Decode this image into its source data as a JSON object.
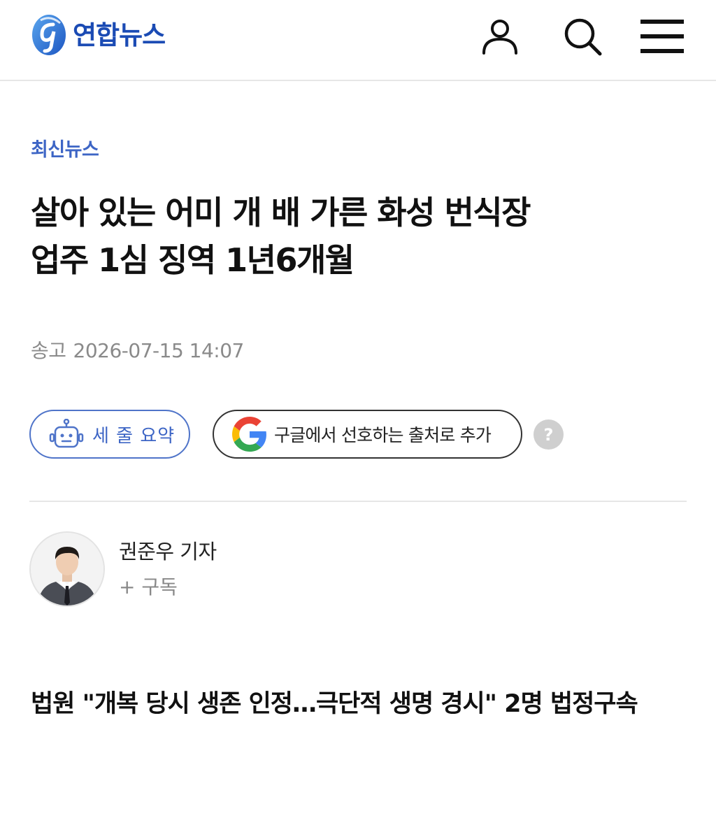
{
  "header": {
    "logo_text": "연합뉴스",
    "brand_color": "#1b4bb4",
    "icons": [
      "user-icon",
      "search-icon",
      "menu-icon"
    ]
  },
  "article": {
    "category": "최신뉴스",
    "headline_line1": "살아 있는 어미 개 배 가른 화성 번식장",
    "headline_line2": "업주 1심 징역 1년6개월",
    "date_label": "송고",
    "date_value": "2026-07-15 14:07",
    "summary_button": "세 줄 요약",
    "google_button": "구글에서 선호하는 출처로 추가",
    "help_label": "?",
    "reporter_name": "권준우 기자",
    "subscribe_label": "+ 구독",
    "subheadline": "법원 \"개복 당시 생존 인정…극단적 생명 경시\" 2명 법정구속"
  },
  "colors": {
    "accent": "#3d65c5",
    "muted": "#8a8a8a",
    "divider": "#e6e6e6"
  }
}
